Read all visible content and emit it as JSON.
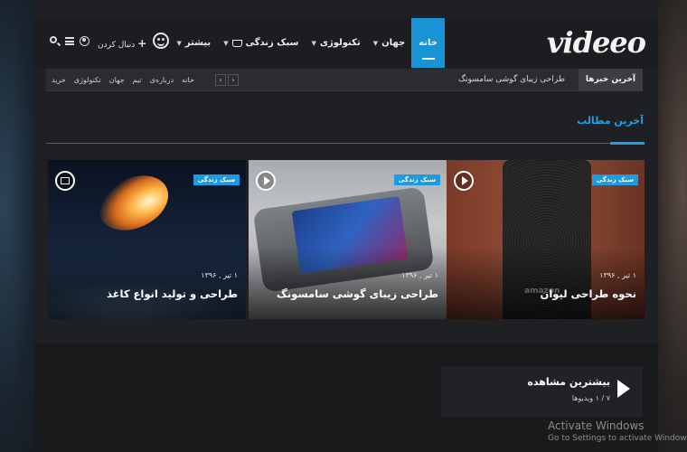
{
  "header": {
    "logo": "videeo",
    "nav": [
      {
        "label": "خانه",
        "active": true
      },
      {
        "label": "جهان",
        "dropdown": true
      },
      {
        "label": "تکنولوژی",
        "dropdown": true
      },
      {
        "label": "سبک زندگی",
        "dropdown": true,
        "icon": "cup-icon"
      },
      {
        "label": "بیشتر",
        "dropdown": true
      }
    ],
    "follow_label": "دنبال کردن",
    "follow_plus": "+"
  },
  "ticker": {
    "label": "آخرین خبرها",
    "headline": "طراحی زیبای گوشی سامسونگ",
    "prev": "‹",
    "next": "›",
    "links": [
      "خانه",
      "درباره‌ی",
      "تیم",
      "جهان",
      "تکنولوژی",
      "خرید"
    ]
  },
  "section": {
    "title": "آخرین مطالب"
  },
  "cards": [
    {
      "badge": "سبک زندگی",
      "date": "۱ تیر , ۱۳۹۶",
      "title": "نحوه طراحی لیوان",
      "brand": "amazon",
      "media": "play-icon"
    },
    {
      "badge": "سبک زندگی",
      "date": "۱ تیر , ۱۳۹۶",
      "title": "طراحی زیبای گوشی سامسونگ",
      "media": "play-icon"
    },
    {
      "badge": "سبک زندگی",
      "date": "۱ تیر , ۱۳۹۶",
      "title": "طراحی و تولید انواع کاغذ",
      "media": "camera-icon"
    }
  ],
  "popular": {
    "title": "بیشترین مشاهده",
    "count": "۷ / ۱ ویدیوها"
  },
  "watermark": {
    "title": "Activate Windows",
    "subtitle": "Go to Settings to activate Windows."
  },
  "colors": {
    "accent": "#1e9be0",
    "background": "#1f2023"
  }
}
